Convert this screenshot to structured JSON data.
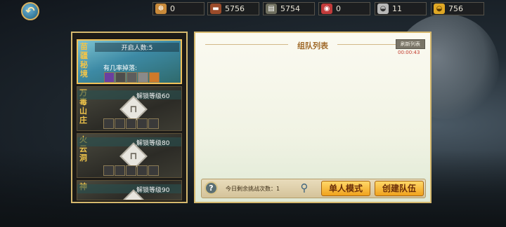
{
  "header": {
    "back_glyph": "↶",
    "resources": [
      {
        "icon": "scroll-icon",
        "glyph": "☸",
        "color": "#c98a3a",
        "value": "0"
      },
      {
        "icon": "wood-icon",
        "glyph": "▬",
        "color": "#9b4b2a",
        "value": "5756"
      },
      {
        "icon": "stone-icon",
        "glyph": "▤",
        "color": "#6f6f5f",
        "value": "5754"
      },
      {
        "icon": "token-icon",
        "glyph": "◉",
        "color": "#c23b3b",
        "value": "0"
      },
      {
        "icon": "silver-ingot-icon",
        "glyph": "◒",
        "color": "#b8b8b8",
        "value": "11"
      },
      {
        "icon": "gold-ingot-icon",
        "glyph": "◒",
        "color": "#e0a825",
        "value": "756"
      }
    ]
  },
  "dungeons": [
    {
      "title": "苗疆秘境",
      "header": "开启人数:5",
      "drop_label": "有几率掉落:",
      "active": true
    },
    {
      "title": "万毒山庄",
      "unlock": "解锁等级60",
      "active": false
    },
    {
      "title": "火云洞",
      "unlock": "解锁等级80",
      "active": false
    },
    {
      "title": "神",
      "unlock": "解锁等级90",
      "active": false
    }
  ],
  "lock_glyph": "⊓",
  "team_panel": {
    "title": "组队列表",
    "refresh_label": "刷新列表",
    "timer": "00:00:43"
  },
  "bottom": {
    "help_glyph": "?",
    "challenge_text": "今日剩余挑战次数：1",
    "magnify_glyph": "⚲",
    "solo_button": "单人模式",
    "create_team_button": "创建队伍"
  }
}
